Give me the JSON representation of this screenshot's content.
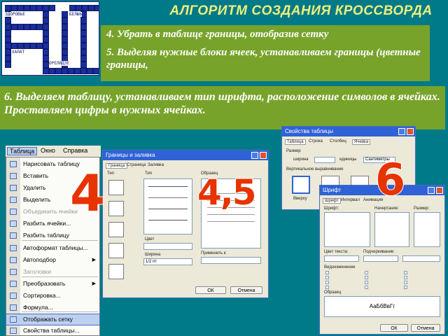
{
  "slide": {
    "title": "АЛГОРИТМ СОЗДАНИЯ КРОССВОРДА",
    "step4": "4. Убрать в таблице границы, отобразив сетку",
    "step5": "5. Выделяя нужные блоки ячеек, устанавливаем границы (цветные границы,",
    "step6": "6. Выделяем таблицу, устанавливаем тип шрифта, расположение символов в ячейках. Проставляем цифры в нужных ячейках.",
    "badge_4": "4",
    "badge_45": "4,5",
    "badge_6": "6"
  },
  "colors": {
    "background": "#007a88",
    "title": "#f0f07a",
    "text_box": "#77a32a",
    "badge": "#e63300"
  },
  "crossword_thumbnail": {
    "row1_word": "ЗДОРОВЬЕ",
    "row1_end": "БЕЛЫЬ",
    "row4_word": "ХАЛАТ",
    "row8_word": "ОРЕЛИДЗЕ"
  },
  "table_menu": {
    "menubar": [
      "Таблица",
      "Окно",
      "Справка"
    ],
    "items": [
      {
        "label": "Нарисовать таблицу",
        "submenu": false,
        "highlight": false,
        "disabled": false
      },
      {
        "label": "Вставить",
        "submenu": true,
        "highlight": false,
        "disabled": false
      },
      {
        "label": "Удалить",
        "submenu": true,
        "highlight": false,
        "disabled": false
      },
      {
        "label": "Выделить",
        "submenu": true,
        "highlight": false,
        "disabled": false
      },
      {
        "label": "Объединить ячейки",
        "submenu": false,
        "highlight": false,
        "disabled": true
      },
      {
        "label": "Разбить ячейки...",
        "submenu": false,
        "highlight": false,
        "disabled": false
      },
      {
        "label": "Разбить таблицу",
        "submenu": false,
        "highlight": false,
        "disabled": false
      },
      {
        "label": "Автоформат таблицы...",
        "submenu": false,
        "highlight": false,
        "disabled": false
      },
      {
        "label": "Автоподбор",
        "submenu": true,
        "highlight": false,
        "disabled": false
      },
      {
        "label": "Заголовки",
        "submenu": false,
        "highlight": false,
        "disabled": true
      },
      {
        "label": "Преобразовать",
        "submenu": true,
        "highlight": false,
        "disabled": false
      },
      {
        "label": "Сортировка...",
        "submenu": false,
        "highlight": false,
        "disabled": false
      },
      {
        "label": "Формула...",
        "submenu": false,
        "highlight": false,
        "disabled": false
      },
      {
        "label": "Отображать сетку",
        "submenu": false,
        "highlight": true,
        "disabled": false
      },
      {
        "label": "Свойства таблицы...",
        "submenu": false,
        "highlight": false,
        "disabled": false
      }
    ]
  },
  "borders_dialog": {
    "title": "Границы и заливка",
    "tabs": [
      "Граница",
      "Страница",
      "Заливка"
    ],
    "labels": {
      "type": "Тип",
      "style": "Тип",
      "sample": "Образец",
      "color": "Цвет",
      "width": "Ширина",
      "apply": "Применить к:"
    },
    "width_value": "1/2 пт",
    "ok": "ОК",
    "cancel": "Отмена"
  },
  "table_props_dialog": {
    "title": "Свойства таблицы",
    "tabs": [
      "Таблица",
      "Строка",
      "Столбец",
      "Ячейка"
    ],
    "labels": {
      "size": "Размер",
      "width": "ширина",
      "units": "единицы",
      "units_value": "Сантиметры",
      "align": "Вертикальное выравнивание",
      "top": "Вверху"
    }
  },
  "font_dialog": {
    "title": "Шрифт",
    "tabs": [
      "Шрифт",
      "Интервал",
      "Анимация"
    ],
    "labels": {
      "font": "Шрифт:",
      "style": "Начертание:",
      "size": "Размер:",
      "color": "Цвет текста:",
      "underline": "Подчеркивание:",
      "effects": "Видоизменение",
      "sample": "Образец"
    },
    "sample_text": "АаБбВвГг",
    "ok": "ОК",
    "cancel": "Отмена"
  }
}
